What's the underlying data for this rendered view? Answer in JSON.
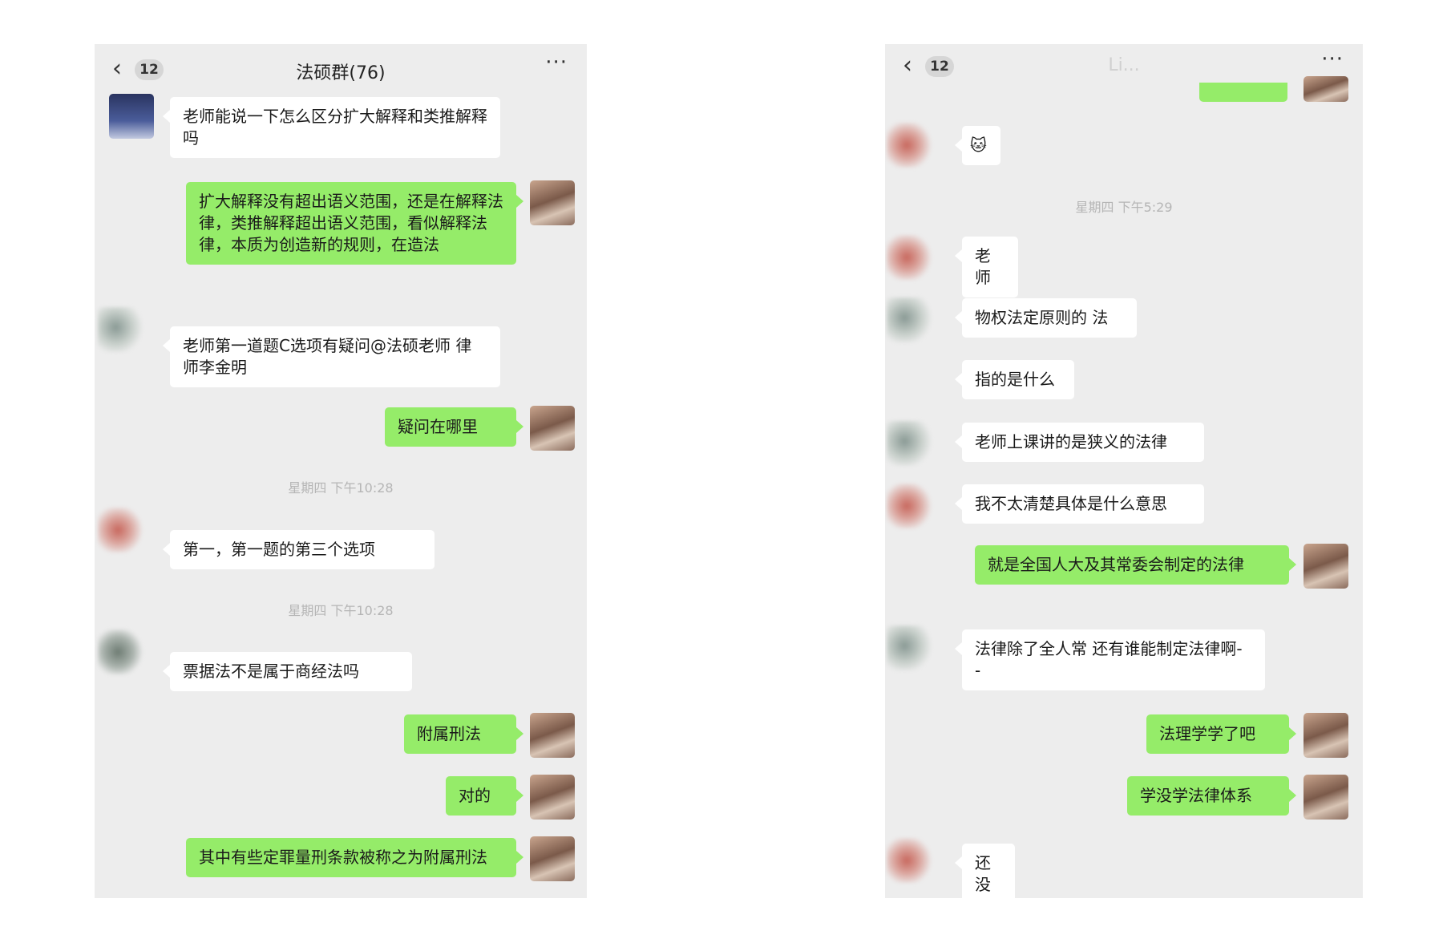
{
  "left": {
    "back_count": "12",
    "title": "法硕群(76)",
    "more": "···",
    "messages": [
      "老师能说一下怎么区分扩大解释和类推解释吗",
      "扩大解释没有超出语义范围，还是在解释法律，类推解释超出语义范围，看似解释法律，本质为创造新的规则，在造法",
      "老师第一道题C选项有疑问@法硕老师 律师李金明",
      "疑问在哪里",
      "第一，第一题的第三个选项",
      "票据法不是属于商经法吗",
      "附属刑法",
      "对的",
      "其中有些定罪量刑条款被称之为附属刑法"
    ],
    "timestamps": [
      "星期四 下午10:28",
      "星期四 下午10:28"
    ]
  },
  "right": {
    "back_count": "12",
    "title": "Li...",
    "more": "···",
    "messages": [
      "🐱",
      "老师",
      "物权法定原则的 法",
      "指的是什么",
      "老师上课讲的是狭义的法律",
      "我不太清楚具体是什么意思",
      "就是全国人大及其常委会制定的法律",
      "法律除了全人常 还有谁能制定法律啊- -",
      "法理学学了吧",
      "学没学法律体系",
      "还没"
    ],
    "timestamps": [
      "星期四 下午5:29"
    ]
  }
}
